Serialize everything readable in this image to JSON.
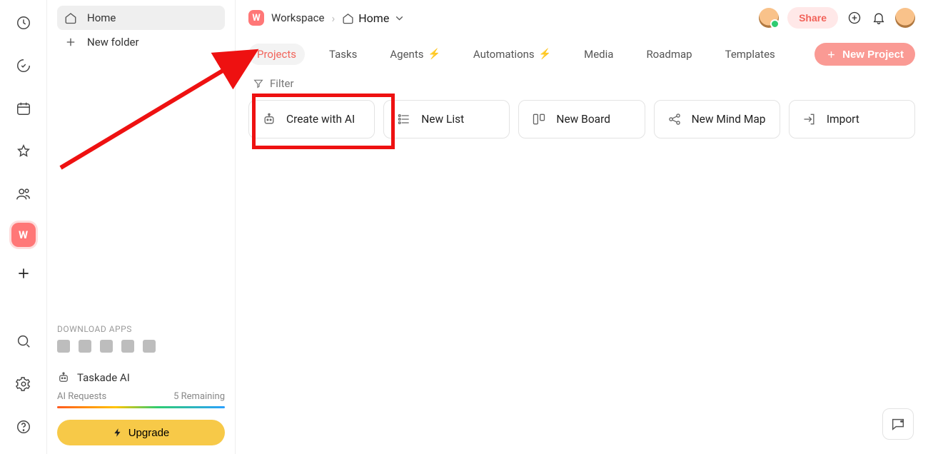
{
  "workspace_initial": "W",
  "breadcrumb": {
    "workspace": "Workspace",
    "home": "Home"
  },
  "share_label": "Share",
  "sidebar": {
    "home": "Home",
    "new_folder": "New folder",
    "download_apps": "DOWNLOAD APPS",
    "taskade_ai": "Taskade AI",
    "ai_requests": "AI Requests",
    "remaining": "5 Remaining",
    "upgrade": "Upgrade"
  },
  "tabs": {
    "projects": "Projects",
    "tasks": "Tasks",
    "agents": "Agents",
    "automations": "Automations",
    "media": "Media",
    "roadmap": "Roadmap",
    "templates": "Templates"
  },
  "new_project": "New Project",
  "filter": "Filter",
  "cards": {
    "create_ai": "Create with AI",
    "new_list": "New List",
    "new_board": "New Board",
    "new_mindmap": "New Mind Map",
    "import": "Import"
  }
}
